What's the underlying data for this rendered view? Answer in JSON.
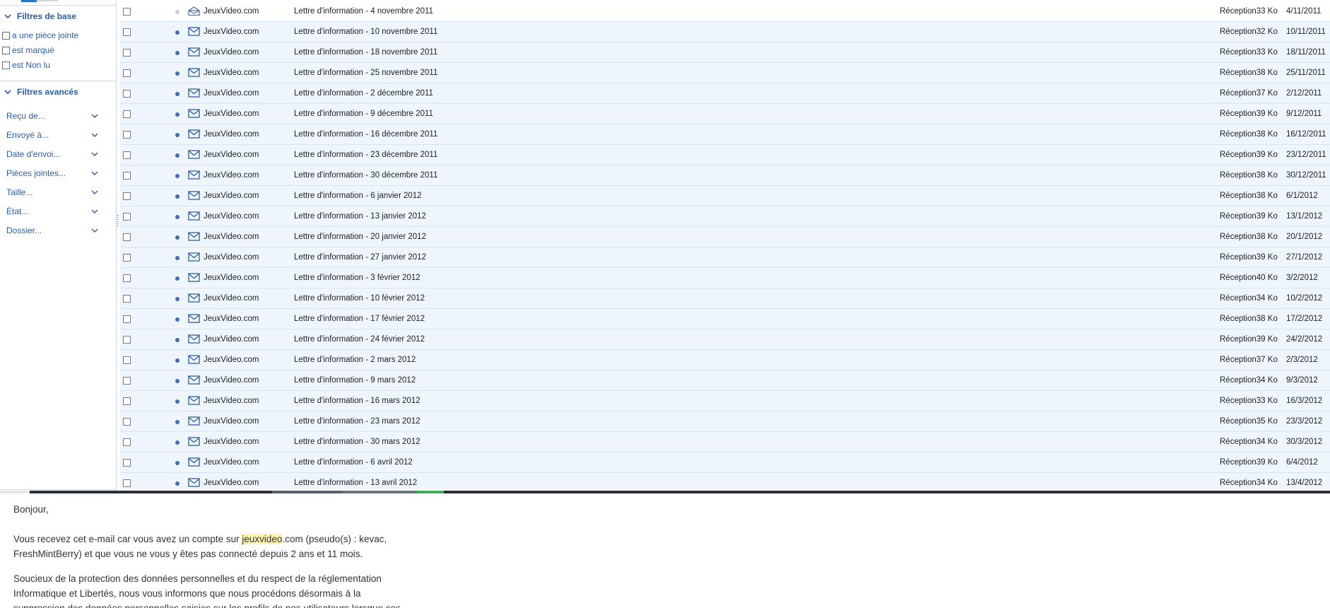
{
  "sidebar": {
    "basic_filters": {
      "title": "Filtres de base",
      "items": [
        "a une pièce jointe",
        "est marqué",
        "est Non lu"
      ]
    },
    "advanced_filters": {
      "title": "Filtres avancés",
      "items": [
        "Reçu de...",
        "Envoyé à...",
        "Date d'envoi...",
        "Pièces jointes...",
        "Taille...",
        "État...",
        "Dossier..."
      ]
    }
  },
  "messages": [
    {
      "sender": "JeuxVideo.com",
      "subject": "Lettre d'information - 4 novembre 2011",
      "size": "Réception33 Ko",
      "date": "4/11/2011",
      "read": true
    },
    {
      "sender": "JeuxVideo.com",
      "subject": "Lettre d'information - 10 novembre 2011",
      "size": "Réception32 Ko",
      "date": "10/11/2011"
    },
    {
      "sender": "JeuxVideo.com",
      "subject": "Lettre d'information - 18 novembre 2011",
      "size": "Réception33 Ko",
      "date": "18/11/2011"
    },
    {
      "sender": "JeuxVideo.com",
      "subject": "Lettre d'information - 25 novembre 2011",
      "size": "Réception38 Ko",
      "date": "25/11/2011"
    },
    {
      "sender": "JeuxVideo.com",
      "subject": "Lettre d'information - 2 décembre 2011",
      "size": "Réception37 Ko",
      "date": "2/12/2011"
    },
    {
      "sender": "JeuxVideo.com",
      "subject": "Lettre d'information - 9 décembre 2011",
      "size": "Réception39 Ko",
      "date": "9/12/2011"
    },
    {
      "sender": "JeuxVideo.com",
      "subject": "Lettre d'information - 16 décembre 2011",
      "size": "Réception38 Ko",
      "date": "16/12/2011"
    },
    {
      "sender": "JeuxVideo.com",
      "subject": "Lettre d'information - 23 décembre 2011",
      "size": "Réception39 Ko",
      "date": "23/12/2011"
    },
    {
      "sender": "JeuxVideo.com",
      "subject": "Lettre d'information - 30 décembre 2011",
      "size": "Réception38 Ko",
      "date": "30/12/2011"
    },
    {
      "sender": "JeuxVideo.com",
      "subject": "Lettre d'information - 6 janvier 2012",
      "size": "Réception38 Ko",
      "date": "6/1/2012"
    },
    {
      "sender": "JeuxVideo.com",
      "subject": "Lettre d'information - 13 janvier 2012",
      "size": "Réception39 Ko",
      "date": "13/1/2012"
    },
    {
      "sender": "JeuxVideo.com",
      "subject": "Lettre d'information - 20 janvier 2012",
      "size": "Réception38 Ko",
      "date": "20/1/2012"
    },
    {
      "sender": "JeuxVideo.com",
      "subject": "Lettre d'information - 27 janvier 2012",
      "size": "Réception39 Ko",
      "date": "27/1/2012"
    },
    {
      "sender": "JeuxVideo.com",
      "subject": "Lettre d'information - 3 février 2012",
      "size": "Réception40 Ko",
      "date": "3/2/2012"
    },
    {
      "sender": "JeuxVideo.com",
      "subject": "Lettre d'information - 10 février 2012",
      "size": "Réception34 Ko",
      "date": "10/2/2012"
    },
    {
      "sender": "JeuxVideo.com",
      "subject": "Lettre d'information - 17 février 2012",
      "size": "Réception38 Ko",
      "date": "17/2/2012"
    },
    {
      "sender": "JeuxVideo.com",
      "subject": "Lettre d'information - 24 février 2012",
      "size": "Réception39 Ko",
      "date": "24/2/2012"
    },
    {
      "sender": "JeuxVideo.com",
      "subject": "Lettre d'information - 2 mars 2012",
      "size": "Réception37 Ko",
      "date": "2/3/2012"
    },
    {
      "sender": "JeuxVideo.com",
      "subject": "Lettre d'information - 9 mars 2012",
      "size": "Réception34 Ko",
      "date": "9/3/2012"
    },
    {
      "sender": "JeuxVideo.com",
      "subject": "Lettre d'information - 16 mars 2012",
      "size": "Réception33 Ko",
      "date": "16/3/2012"
    },
    {
      "sender": "JeuxVideo.com",
      "subject": "Lettre d'information - 23 mars 2012",
      "size": "Réception35 Ko",
      "date": "23/3/2012"
    },
    {
      "sender": "JeuxVideo.com",
      "subject": "Lettre d'information - 30 mars 2012",
      "size": "Réception34 Ko",
      "date": "30/3/2012"
    },
    {
      "sender": "JeuxVideo.com",
      "subject": "Lettre d'information - 6 avril 2012",
      "size": "Réception39 Ko",
      "date": "6/4/2012"
    },
    {
      "sender": "JeuxVideo.com",
      "subject": "Lettre d'information - 13 avril 2012",
      "size": "Réception34 Ko",
      "date": "13/4/2012"
    }
  ],
  "reading_pane": {
    "greeting": "Bonjour,",
    "p1_before": "Vous recevez cet e-mail car vous avez un compte sur ",
    "p1_highlight": "jeuxvideo",
    "p1_line1_after": ".com (pseudo(s) : kevac,",
    "p1_line2": "FreshMintBerry) et que vous ne vous y êtes pas connecté depuis 2 ans et 11 mois.",
    "p2_line1": "Soucieux de la protection des données personnelles et du respect de la réglementation",
    "p2_line2": "Informatique et Libertés, nous vous informons que nous procédons désormais à la",
    "p2_line3": "suppression des données personnelles saisies sur les profils de nos utilisateurs lorsque ces"
  }
}
